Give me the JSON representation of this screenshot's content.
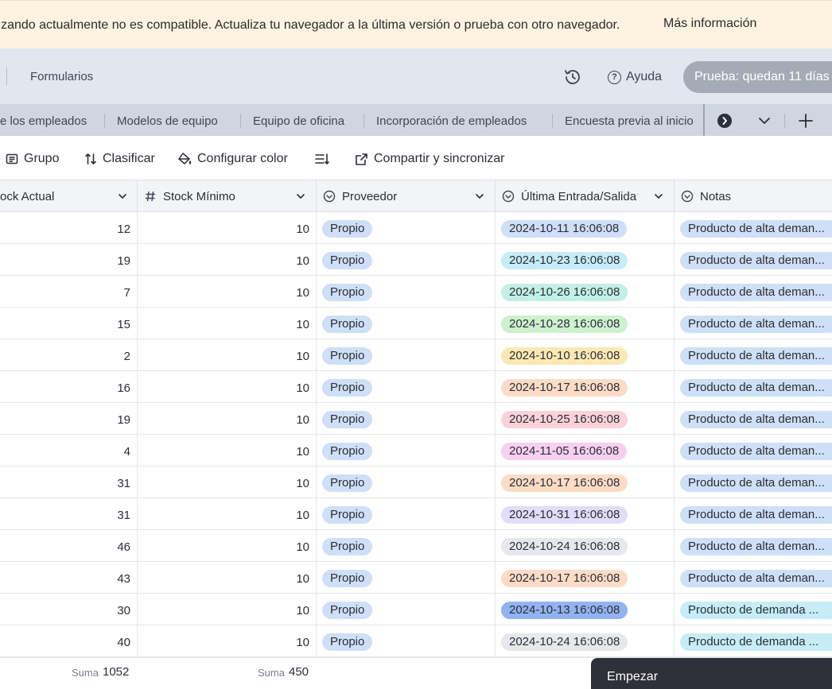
{
  "banner": {
    "text": "lizando actualmente no es compatible. Actualiza tu navegador a la última versión o prueba con otro navegador.",
    "link": "Más información"
  },
  "topbar": {
    "forms_tab": "Formularios",
    "help_label": "Ayuda",
    "trial_label": "Prueba: quedan 11 días",
    "history_icon": "history-icon"
  },
  "tabs": [
    {
      "label": "e los empleados"
    },
    {
      "label": "Modelos de equipo"
    },
    {
      "label": "Equipo de oficina"
    },
    {
      "label": "Incorporación de empleados"
    },
    {
      "label": "Encuesta previa al inicio"
    }
  ],
  "toolbar": {
    "group": "Grupo",
    "sort": "Clasificar",
    "color": "Configurar color",
    "share": "Compartir y sincronizar"
  },
  "columns": {
    "stock_actual": "ock Actual",
    "stock_minimo": "Stock Mínimo",
    "proveedor": "Proveedor",
    "ultima": "Última Entrada/Salida",
    "notas": "Notas"
  },
  "date_colors": {
    "blue": "#cfdff7",
    "cyan": "#c6ecf6",
    "teal": "#c3f0e6",
    "green": "#cdf1cf",
    "yellow": "#fbe8b4",
    "orange": "#fcdcc6",
    "pink": "#fbd2dc",
    "magenta": "#f7d0f0",
    "purple": "#e1dcf8",
    "gray": "#e6e8ec",
    "strongblue": "#91b4f0"
  },
  "note_colors": {
    "blue": "#cfdff7",
    "cyan": "#c6ecf6"
  },
  "rows": [
    {
      "stock": "12",
      "min": "10",
      "prov": "Propio",
      "date": "2024-10-11 16:06:08",
      "date_color": "blue",
      "note": "Producto de alta deman...",
      "note_color": "blue"
    },
    {
      "stock": "19",
      "min": "10",
      "prov": "Propio",
      "date": "2024-10-23 16:06:08",
      "date_color": "cyan",
      "note": "Producto de alta deman...",
      "note_color": "blue"
    },
    {
      "stock": "7",
      "min": "10",
      "prov": "Propio",
      "date": "2024-10-26 16:06:08",
      "date_color": "teal",
      "note": "Producto de alta deman...",
      "note_color": "blue"
    },
    {
      "stock": "15",
      "min": "10",
      "prov": "Propio",
      "date": "2024-10-28 16:06:08",
      "date_color": "green",
      "note": "Producto de alta deman...",
      "note_color": "blue"
    },
    {
      "stock": "2",
      "min": "10",
      "prov": "Propio",
      "date": "2024-10-10 16:06:08",
      "date_color": "yellow",
      "note": "Producto de alta deman...",
      "note_color": "blue"
    },
    {
      "stock": "16",
      "min": "10",
      "prov": "Propio",
      "date": "2024-10-17 16:06:08",
      "date_color": "orange",
      "note": "Producto de alta deman...",
      "note_color": "blue"
    },
    {
      "stock": "19",
      "min": "10",
      "prov": "Propio",
      "date": "2024-10-25 16:06:08",
      "date_color": "pink",
      "note": "Producto de alta deman...",
      "note_color": "blue"
    },
    {
      "stock": "4",
      "min": "10",
      "prov": "Propio",
      "date": "2024-11-05 16:06:08",
      "date_color": "magenta",
      "note": "Producto de alta deman...",
      "note_color": "blue"
    },
    {
      "stock": "31",
      "min": "10",
      "prov": "Propio",
      "date": "2024-10-17 16:06:08",
      "date_color": "orange",
      "note": "Producto de alta deman...",
      "note_color": "blue"
    },
    {
      "stock": "31",
      "min": "10",
      "prov": "Propio",
      "date": "2024-10-31 16:06:08",
      "date_color": "purple",
      "note": "Producto de alta deman...",
      "note_color": "blue"
    },
    {
      "stock": "46",
      "min": "10",
      "prov": "Propio",
      "date": "2024-10-24 16:06:08",
      "date_color": "gray",
      "note": "Producto de alta deman...",
      "note_color": "blue"
    },
    {
      "stock": "43",
      "min": "10",
      "prov": "Propio",
      "date": "2024-10-17 16:06:08",
      "date_color": "orange",
      "note": "Producto de alta deman...",
      "note_color": "blue"
    },
    {
      "stock": "30",
      "min": "10",
      "prov": "Propio",
      "date": "2024-10-13 16:06:08",
      "date_color": "strongblue",
      "note": "Producto de demanda ...",
      "note_color": "cyan"
    },
    {
      "stock": "40",
      "min": "10",
      "prov": "Propio",
      "date": "2024-10-24 16:06:08",
      "date_color": "gray",
      "note": "Producto de demanda ...",
      "note_color": "cyan"
    }
  ],
  "footer": {
    "sum_label": "Suma",
    "sum_stock": "1052",
    "sum_min": "450",
    "start_button": "Empezar"
  }
}
